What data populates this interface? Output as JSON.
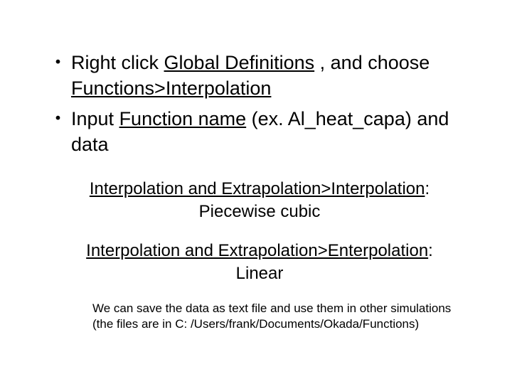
{
  "bullets": {
    "b1": {
      "pre": "Right click ",
      "u1": "Global Definitions",
      "mid1": " , and choose ",
      "u2": "Functions>Interpolation"
    },
    "b2": {
      "pre": "Input ",
      "u1": "Function name",
      "post": " (ex. Al_heat_capa) and data"
    }
  },
  "mid1": {
    "u": "Interpolation and Extrapolation>Interpolation",
    "colon": ":",
    "sub": "Piecewise cubic"
  },
  "mid2": {
    "u": "Interpolation and Extrapolation>Enterpolation",
    "colon": ":",
    "sub": "Linear"
  },
  "note": {
    "line1": "We can save the data as text file and use them in other simulations",
    "line2": "(the files are in C: /Users/frank/Documents/Okada/Functions)"
  }
}
